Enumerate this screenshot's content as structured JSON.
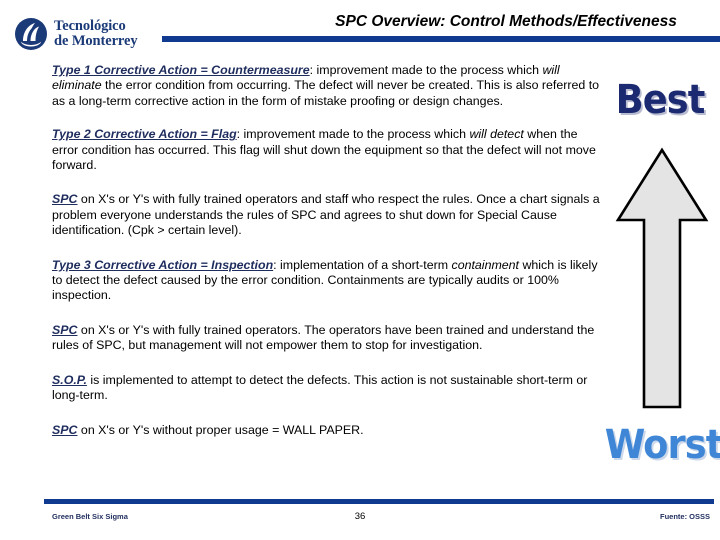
{
  "header": {
    "title": "SPC Overview: Control Methods/Effectiveness",
    "logo": {
      "line1": "Tecnológico",
      "line2": "de Monterrey",
      "icon": "tec-flame-emblem-icon"
    },
    "rule_color": "#103a8f"
  },
  "content": {
    "paragraphs": [
      {
        "id": "para-1",
        "lead": "Type 1 Corrective Action = Countermeasure",
        "text_a": ":  improvement made to the process which ",
        "emph_a": "will eliminate",
        "text_b": " the error condition from occurring.  The defect will never be created.  This is also referred to as a long-term corrective action in the form of mistake proofing or design changes."
      },
      {
        "id": "para-2",
        "lead": "Type 2 Corrective Action = Flag",
        "text_a": ":  improvement made to the process which ",
        "emph_a": "will detect",
        "text_b": " when the error condition has occurred.  This flag will shut down the equipment so that the defect will not move forward."
      },
      {
        "id": "para-3",
        "lead": "SPC",
        "text_a": " on X's or Y's with fully trained operators and staff who respect the rules.  Once a chart signals a problem everyone understands the rules of SPC and agrees to shut down for Special Cause identification. (Cpk > certain level).",
        "emph_a": "",
        "text_b": ""
      },
      {
        "id": "para-4",
        "lead": "Type 3 Corrective Action = Inspection",
        "text_a": ":  implementation of a short-term ",
        "emph_a": "containment",
        "text_b": " which is likely to detect the defect caused by the error condition.  Containments are typically audits or 100% inspection."
      },
      {
        "id": "para-5",
        "lead": "SPC",
        "text_a": " on X's or Y's with fully trained operators.  The operators have been trained and understand the rules of SPC, but management will not empower them to stop for investigation.",
        "emph_a": "",
        "text_b": ""
      },
      {
        "id": "para-6",
        "lead": "S.O.P.",
        "text_a": " is implemented to attempt to detect the defects.  This action is not sustainable short-term or long-term.",
        "emph_a": "",
        "text_b": ""
      },
      {
        "id": "para-7",
        "lead": "SPC",
        "text_a": " on X's or Y's without proper usage = WALL PAPER.",
        "emph_a": "",
        "text_b": ""
      }
    ]
  },
  "ranking": {
    "best_label": "Best",
    "worst_label": "Worst",
    "best_color": "#1c2a72",
    "worst_color": "#3f87d6",
    "arrow_icon": "up-arrow-icon",
    "arrow_fill": "#e4e4e4",
    "arrow_stroke": "#000000"
  },
  "footer": {
    "left": "Green Belt Six Sigma",
    "page": "36",
    "right": "Fuente: OSSS"
  }
}
